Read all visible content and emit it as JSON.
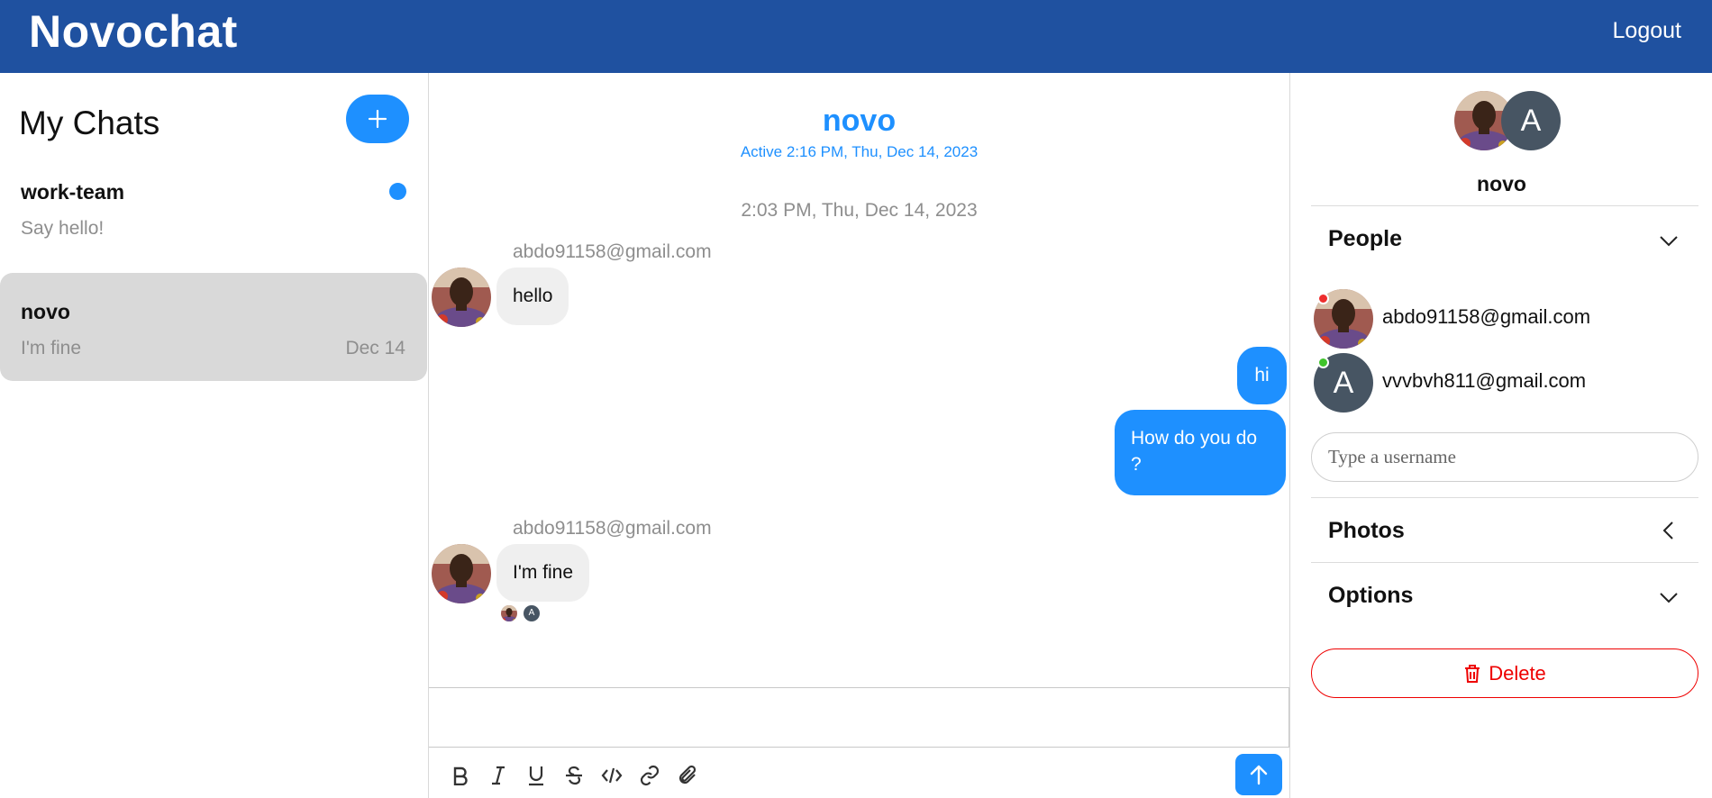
{
  "app": {
    "title": "Novochat",
    "logout_label": "Logout"
  },
  "sidebar": {
    "title": "My Chats",
    "new_chat_icon": "plus-icon",
    "chats": [
      {
        "name": "work-team",
        "preview": "Say hello!",
        "date": "",
        "unread": true
      },
      {
        "name": "novo",
        "preview": "I'm fine",
        "date": "Dec 14",
        "unread": false,
        "active": true
      }
    ]
  },
  "conversation": {
    "title": "novo",
    "status": "Active 2:16 PM, Thu, Dec 14, 2023",
    "timestamp": "2:03 PM, Thu, Dec 14, 2023",
    "messages": [
      {
        "sender": "abdo91158@gmail.com",
        "text": "hello",
        "outgoing": false
      },
      {
        "text": "hi",
        "outgoing": true
      },
      {
        "text_line1": "How do you do",
        "text_line2": "?",
        "outgoing": true
      },
      {
        "sender": "abdo91158@gmail.com",
        "text": "I'm fine",
        "outgoing": false
      }
    ],
    "read_receipt_initial": "A"
  },
  "composer": {
    "tools": [
      "bold-icon",
      "italic-icon",
      "underline-icon",
      "strikethrough-icon",
      "code-icon",
      "link-icon",
      "attachment-icon"
    ],
    "send_icon": "arrow-up-icon"
  },
  "details": {
    "chat_name": "novo",
    "avatar_initial": "A",
    "people_label": "People",
    "people": [
      {
        "email": "abdo91158@gmail.com",
        "online": false,
        "initial": ""
      },
      {
        "email": "vvvbvh811@gmail.com",
        "online": true,
        "initial": "A"
      }
    ],
    "search_placeholder": "Type a username",
    "photos_label": "Photos",
    "options_label": "Options",
    "delete_label": "Delete"
  },
  "colors": {
    "header": "#1f51a0",
    "accent": "#1e90ff",
    "offline": "#ee2d2d",
    "online": "#3fc32a",
    "danger": "#e00000"
  }
}
